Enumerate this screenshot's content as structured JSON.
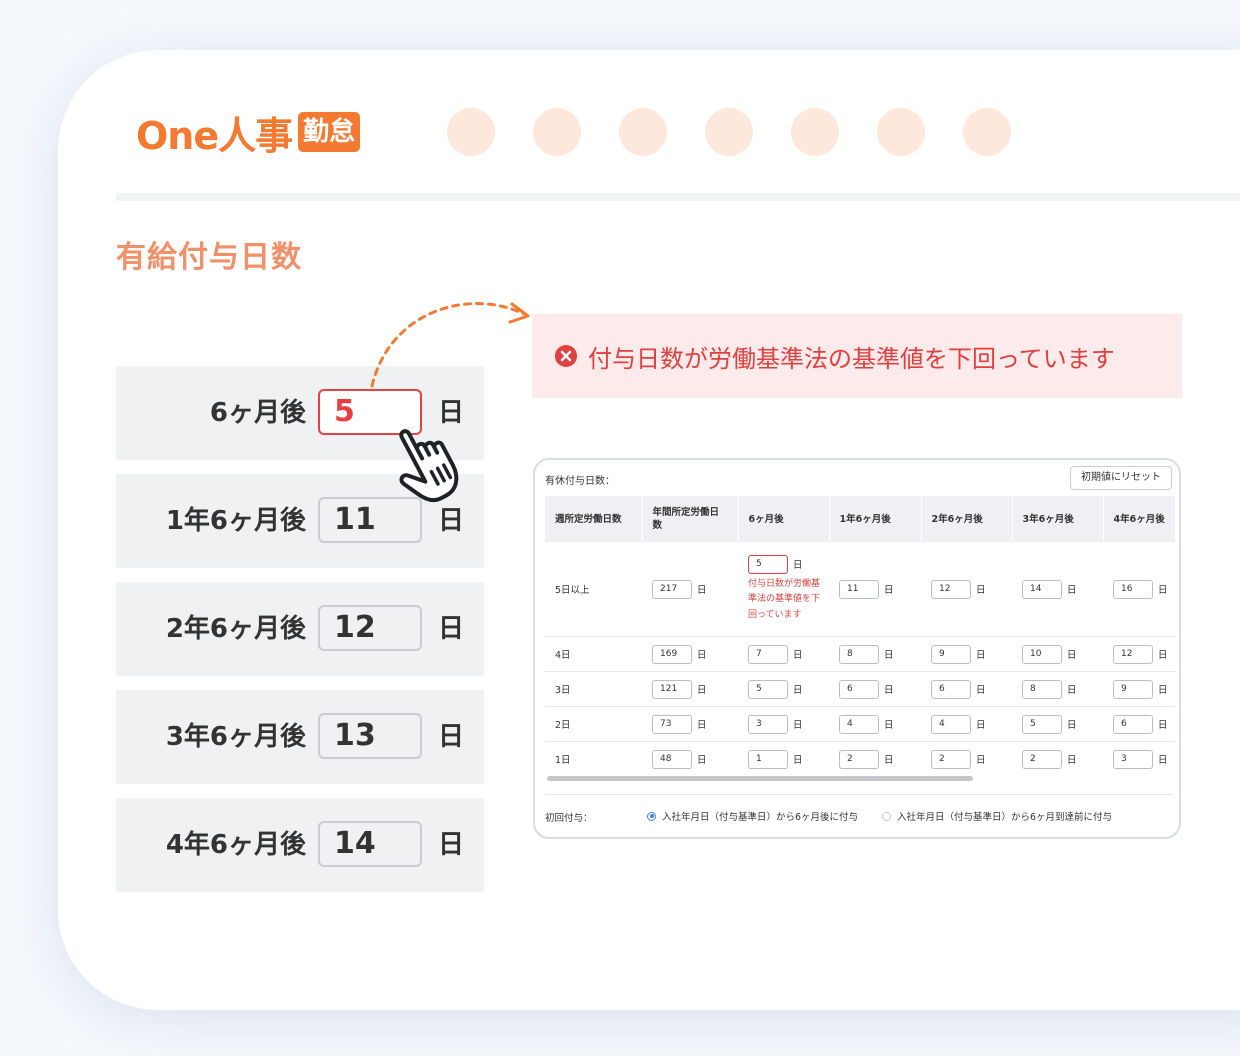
{
  "brand": {
    "name": "One人事",
    "badge": "勤怠",
    "accent": "#f47a31"
  },
  "nav_dots": [
    1,
    2,
    3,
    4,
    5,
    6,
    7
  ],
  "section_title": "有給付与日数",
  "grant_rows": [
    {
      "label": "6ヶ月後",
      "value": "5",
      "unit": "日",
      "error": true
    },
    {
      "label": "1年6ヶ月後",
      "value": "11",
      "unit": "日",
      "error": false
    },
    {
      "label": "2年6ヶ月後",
      "value": "12",
      "unit": "日",
      "error": false
    },
    {
      "label": "3年6ヶ月後",
      "value": "13",
      "unit": "日",
      "error": false
    },
    {
      "label": "4年6ヶ月後",
      "value": "14",
      "unit": "日",
      "error": false
    }
  ],
  "alert": {
    "message": "付与日数が労働基準法の基準値を下回っています",
    "color": "#e0403f"
  },
  "panel": {
    "title": "有休付与日数：",
    "reset_label": "初期値にリセット",
    "headers": [
      "週所定労働日数",
      "年間所定労働日数",
      "6ヶ月後",
      "1年6ヶ月後",
      "2年6ヶ月後",
      "3年6ヶ月後",
      "4年6ヶ月後"
    ],
    "rows": [
      {
        "days": "5日以上",
        "annual": "217",
        "values": [
          "5",
          "11",
          "12",
          "14",
          "16"
        ],
        "error_col": 0,
        "error_msg": "付与日数が労働基準法の基準値を下回っています"
      },
      {
        "days": "4日",
        "annual": "169",
        "values": [
          "7",
          "8",
          "9",
          "10",
          "12"
        ]
      },
      {
        "days": "3日",
        "annual": "121",
        "values": [
          "5",
          "6",
          "6",
          "8",
          "9"
        ]
      },
      {
        "days": "2日",
        "annual": "73",
        "values": [
          "3",
          "4",
          "4",
          "5",
          "6"
        ]
      },
      {
        "days": "1日",
        "annual": "48",
        "values": [
          "1",
          "2",
          "2",
          "2",
          "3"
        ]
      }
    ],
    "unit": "日",
    "first_grant_label": "初回付与：",
    "options": [
      {
        "label": "入社年月日（付与基準日）から6ヶ月後に付与",
        "selected": true
      },
      {
        "label": "入社年月日（付与基準日）から6ヶ月到達前に付与",
        "selected": false
      }
    ]
  }
}
